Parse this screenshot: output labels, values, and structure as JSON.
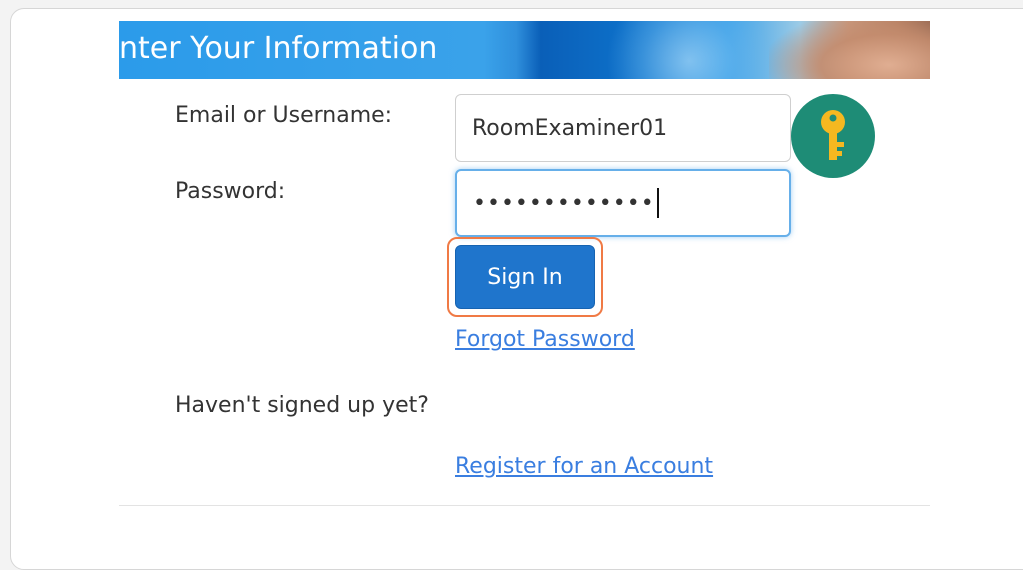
{
  "banner": {
    "title": "nter Your Information"
  },
  "form": {
    "email_label": "Email or Username:",
    "email_value": "RoomExaminer01",
    "password_label": "Password:",
    "password_value": "•••••••••••••",
    "sign_in_label": "Sign In",
    "forgot_password_label": "Forgot Password",
    "signup_prompt": "Haven't signed up yet?",
    "register_label": "Register for an Account"
  },
  "icons": {
    "key": "key-icon"
  },
  "colors": {
    "primary_button": "#1f75cc",
    "focus_outline": "#f07a45",
    "link": "#3a7ee0",
    "key_badge": "#1e8c76",
    "key": "#f5b820"
  }
}
